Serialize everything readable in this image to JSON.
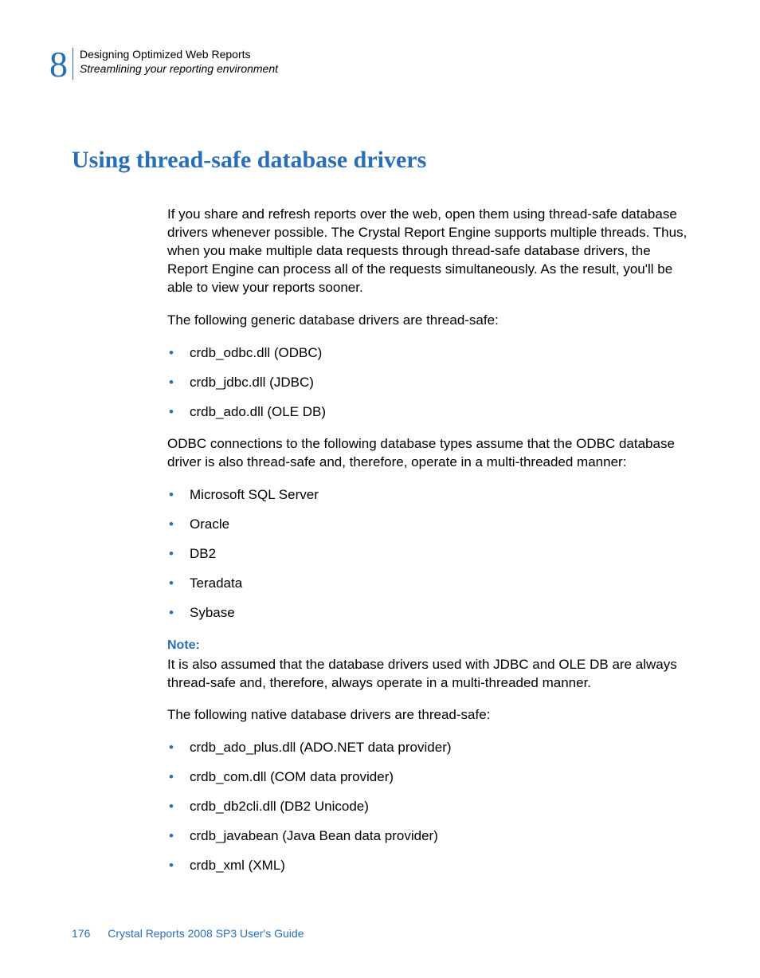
{
  "header": {
    "chapter_number": "8",
    "chapter_title": "Designing Optimized Web Reports",
    "chapter_subtitle": "Streamlining your reporting environment"
  },
  "heading": "Using thread-safe database drivers",
  "para1": "If you share and refresh reports over the web, open them using thread-safe database drivers whenever possible. The Crystal Report Engine supports multiple threads. Thus, when you make multiple data requests through thread-safe database drivers, the Report Engine can process all of the requests simultaneously. As the result, you'll be able to view your reports sooner.",
  "para2": "The following generic database drivers are thread-safe:",
  "list1": [
    "crdb_odbc.dll (ODBC)",
    "crdb_jdbc.dll (JDBC)",
    "crdb_ado.dll (OLE DB)"
  ],
  "para3": "ODBC connections to the following database types assume that the ODBC database driver is also thread-safe and, therefore, operate in a multi-threaded manner:",
  "list2": [
    "Microsoft SQL Server",
    "Oracle",
    "DB2",
    "Teradata",
    "Sybase"
  ],
  "note_label": "Note:",
  "note_text": "It is also assumed that the database drivers used with JDBC and OLE DB are always thread-safe and, therefore, always operate in a multi-threaded manner.",
  "para4": "The following native database drivers are thread-safe:",
  "list3": [
    "crdb_ado_plus.dll (ADO.NET data provider)",
    "crdb_com.dll (COM data provider)",
    "crdb_db2cli.dll (DB2 Unicode)",
    "crdb_javabean (Java Bean data provider)",
    "crdb_xml (XML)"
  ],
  "footer": {
    "page": "176",
    "doc": "Crystal Reports 2008 SP3 User's Guide"
  }
}
